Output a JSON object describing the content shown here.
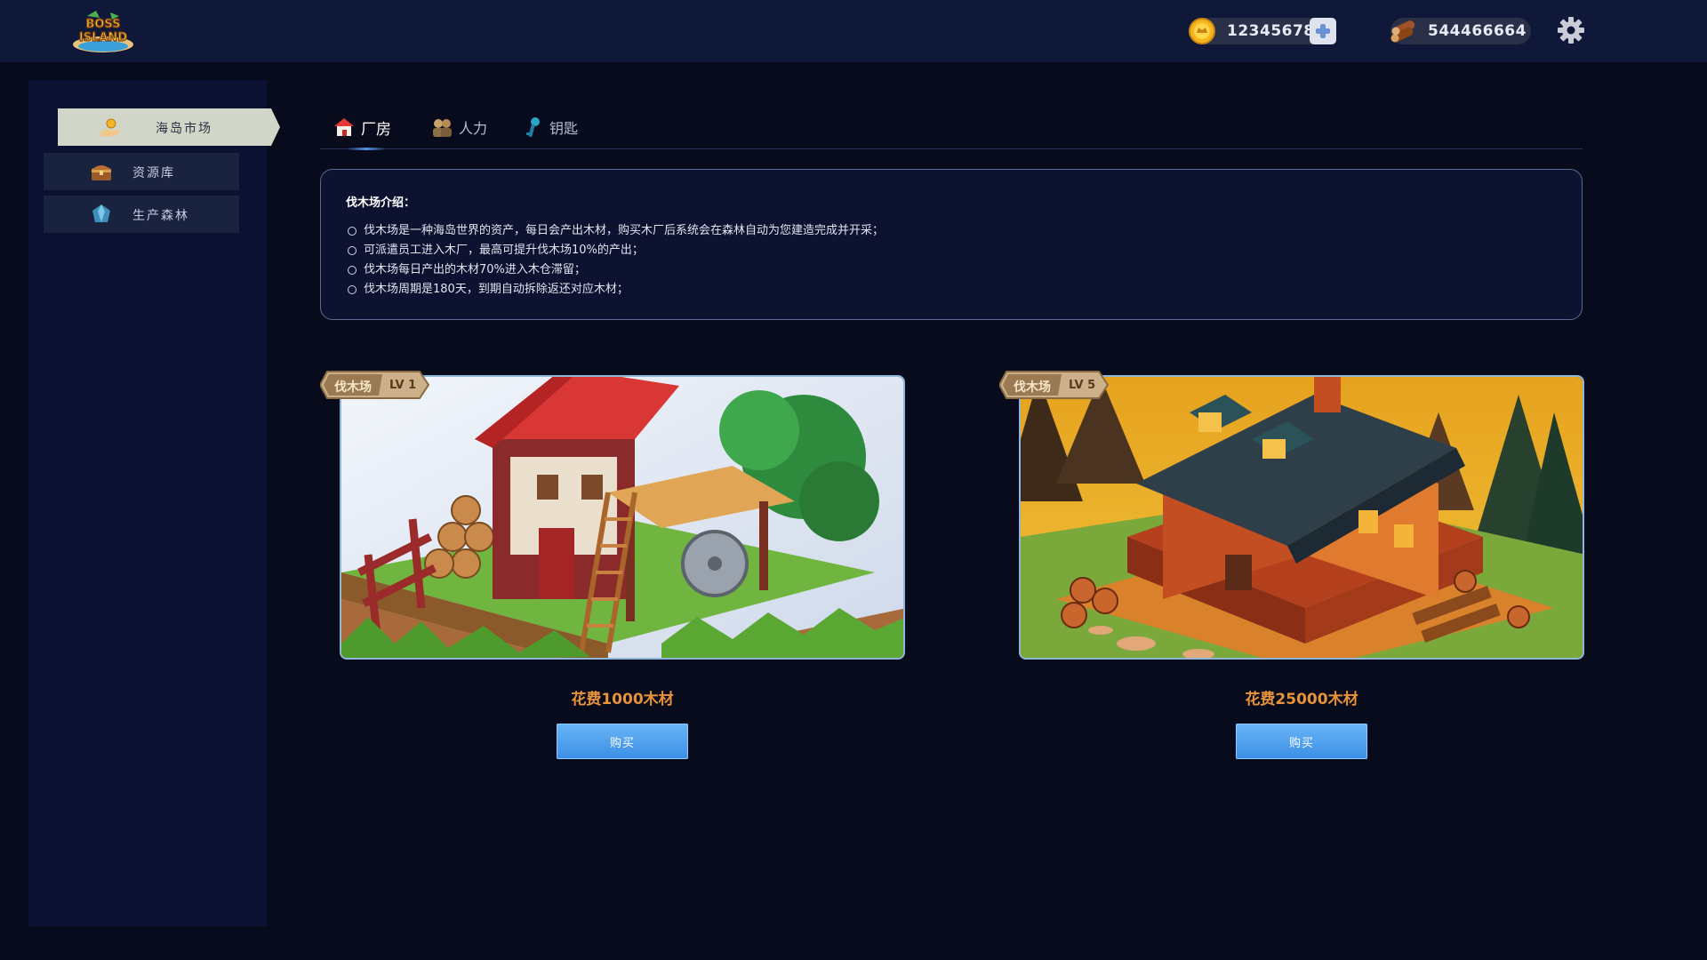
{
  "header": {
    "logo_text": [
      "BOSS",
      "ISLAND"
    ],
    "gold_amount": "12345678",
    "wood_amount": "544466664"
  },
  "sidebar": {
    "items": [
      {
        "label": "海岛市场",
        "icon": "coin-hand-icon",
        "active": true
      },
      {
        "label": "资源库",
        "icon": "treasure-chest-icon",
        "active": false
      },
      {
        "label": "生产森林",
        "icon": "crystal-icon",
        "active": false
      }
    ]
  },
  "tabs": [
    {
      "label": "厂房",
      "icon": "house-icon",
      "active": true
    },
    {
      "label": "人力",
      "icon": "workers-icon",
      "active": false
    },
    {
      "label": "钥匙",
      "icon": "key-icon",
      "active": false
    }
  ],
  "info": {
    "title": "伐木场介绍：",
    "lines": [
      "伐木场是一种海岛世界的资产，每日会产出木材，购买木厂后系统会在森林自动为您建造完成并开采；",
      "可派遣员工进入木厂，最高可提升伐木场10%的产出；",
      "伐木场每日产出的木材70%进入木仓滞留；",
      "伐木场周期是180天，到期自动拆除返还对应木材；"
    ]
  },
  "cards": [
    {
      "badge_name": "伐木场",
      "badge_level": "LV 1",
      "price": "花费1000木材",
      "button": "购买"
    },
    {
      "badge_name": "伐木场",
      "badge_level": "LV 5",
      "price": "花费25000木材",
      "button": "购买"
    }
  ],
  "colors": {
    "background": "#070b1c",
    "topbar": "#0f1838",
    "price_orange": "#e8923a",
    "button_blue": "#4a9eee",
    "active_side_item": "#d2d6c9"
  }
}
